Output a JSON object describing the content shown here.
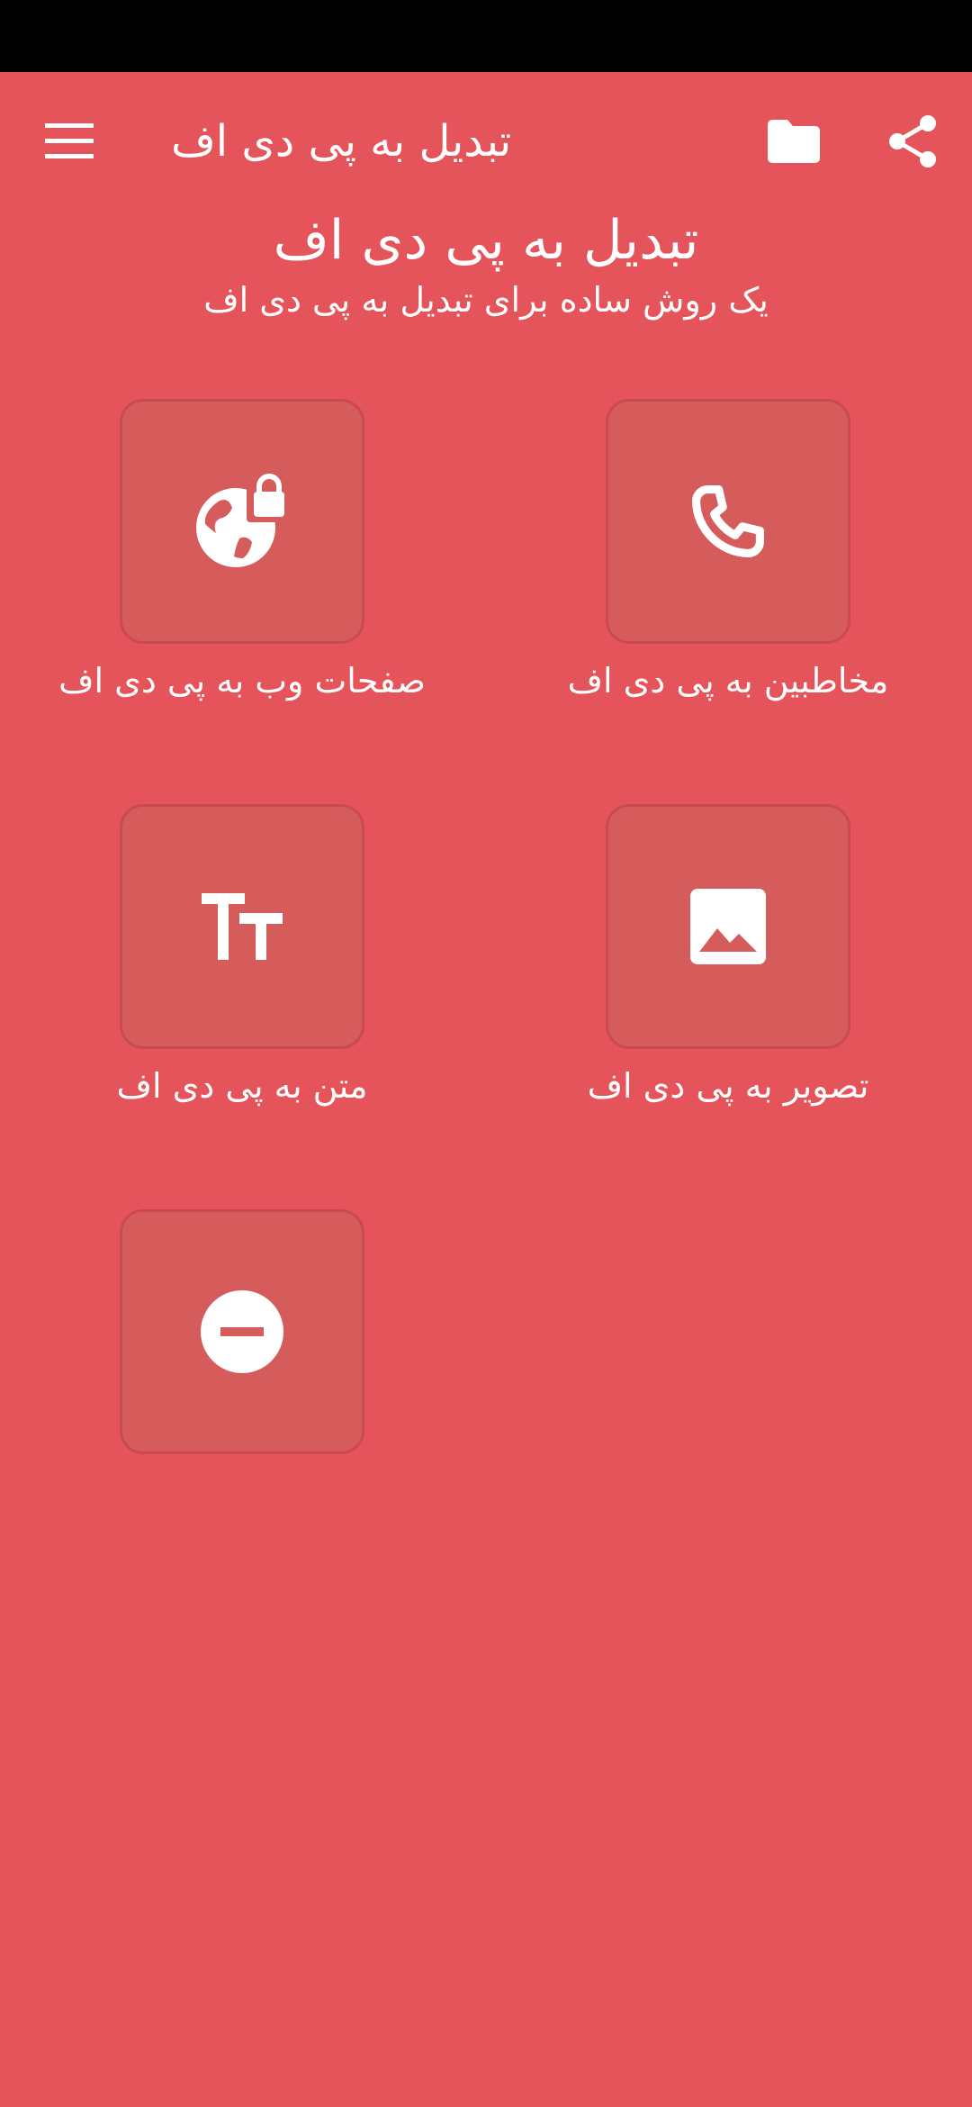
{
  "app_bar": {
    "title": "تبدیل به پی دی اف",
    "menu_icon": "menu-icon",
    "folder_icon": "folder-icon",
    "share_icon": "share-icon"
  },
  "header": {
    "title": "تبدیل به پی دی اف",
    "subtitle": "یک روش ساده برای تبدیل به پی دی اف"
  },
  "tiles": [
    {
      "label": "مخاطبین به پی دی اف",
      "icon": "phone-icon"
    },
    {
      "label": "صفحات وب به پی دی اف",
      "icon": "web-lock-icon"
    },
    {
      "label": "تصویر به پی دی اف",
      "icon": "image-icon"
    },
    {
      "label": "متن به پی دی اف",
      "icon": "text-size-icon"
    },
    {
      "label": "",
      "icon": "remove-circle-icon"
    }
  ],
  "colors": {
    "background": "#E5545A",
    "tile": "#D65C5C",
    "tile_border": "#C94A4F",
    "status_bar": "#000000",
    "foreground": "#FFFFFF"
  }
}
